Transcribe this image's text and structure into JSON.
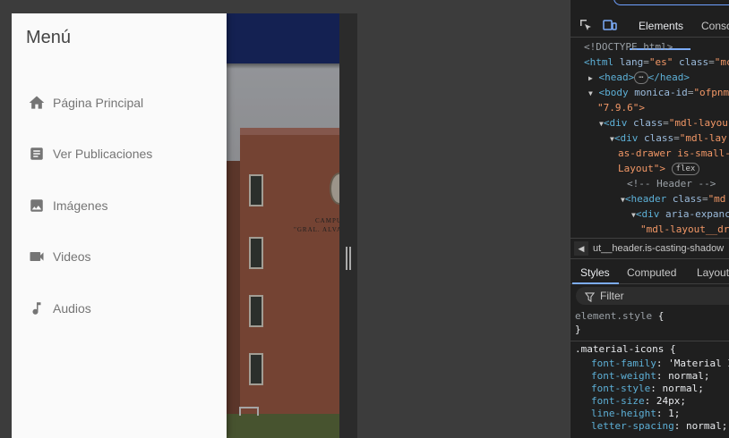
{
  "drawer": {
    "title": "Menú",
    "items": [
      {
        "label": "Página Principal",
        "icon": "home-icon"
      },
      {
        "label": "Ver Publicaciones",
        "icon": "article-icon"
      },
      {
        "label": "Imágenes",
        "icon": "image-icon"
      },
      {
        "label": "Videos",
        "icon": "videocam-icon"
      },
      {
        "label": "Audios",
        "icon": "music-note-icon"
      }
    ]
  },
  "hero": {
    "sign_line_1": "CAMPUS P",
    "sign_line_2": "\"GRAL. ALVARO"
  },
  "colors": {
    "header_bar": "#1b2c6e",
    "drawer_bg": "#fafafa",
    "building": "#9b5a45",
    "devtools_bg": "#1f1f1f",
    "devtools_accent": "#7cacf8"
  },
  "devtools": {
    "tabs": {
      "elements": "Elements",
      "console": "Consc"
    },
    "dom": {
      "doctype": "<!DOCTYPE html>",
      "html_open": "<html",
      "html_lang_attr": "lang",
      "html_lang_val": "\"es\"",
      "html_class_attr": "class",
      "html_class_val": "\"mc",
      "head": "<head>",
      "head_close": "</head>",
      "ellipsis": "⋯",
      "body_open": "<body",
      "body_attr": "monica-id",
      "body_val": "\"ofpnmc",
      "body_val_2": "\"7.9.6\">",
      "div1_open": "<div",
      "div1_attr": "class",
      "div1_val": "\"mdl-layou",
      "div2_open": "<div",
      "div2_attr": "class",
      "div2_val": "\"mdl-lay",
      "div2_val_2": "as-drawer is-small-",
      "div2_val_3": "Layout\">",
      "flex_badge": "flex",
      "comment": "<!-- Header -->",
      "header_open": "<header",
      "header_attr": "class",
      "header_val": "\"md",
      "div3_open": "<div",
      "div3_attr": "aria-expanc",
      "div3_val": "\"mdl-layout__dra"
    },
    "breadcrumb": "ut__header.is-casting-shadow",
    "sub_tabs": {
      "styles": "Styles",
      "computed": "Computed",
      "layout": "Layout"
    },
    "filter_label": "Filter",
    "css": {
      "element_style": "element.style",
      "brace_open": " {",
      "brace_close": "}",
      "selector": ".material-icons",
      "props": [
        {
          "name": "font-family",
          "value": "'Material I"
        },
        {
          "name": "font-weight",
          "value": "normal;"
        },
        {
          "name": "font-style",
          "value": "normal;"
        },
        {
          "name": "font-size",
          "value": "24px;"
        },
        {
          "name": "line-height",
          "value": "1;"
        },
        {
          "name": "letter-spacing",
          "value": "normal;"
        }
      ]
    }
  }
}
